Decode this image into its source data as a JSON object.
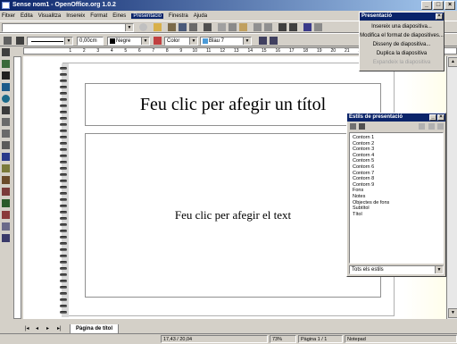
{
  "window": {
    "title": "Sense nom1 - OpenOffice.org 1.0.2"
  },
  "menubar": [
    "Fitxer",
    "Edita",
    "Visualitza",
    "Insereix",
    "Format",
    "Eines",
    "Presentació",
    "Finestra",
    "Ajuda"
  ],
  "toolbar": {
    "line_width": "0,00cm",
    "line_color": "Negre",
    "fill_type": "Color",
    "fill_color": "Blau 7"
  },
  "ruler": {
    "ticks": [
      "1",
      "2",
      "3",
      "4",
      "5",
      "6",
      "7",
      "8",
      "9",
      "10",
      "11",
      "12",
      "13",
      "14",
      "15",
      "16",
      "17",
      "18",
      "19",
      "20",
      "21",
      "22",
      "23",
      "24"
    ]
  },
  "slide": {
    "title_placeholder": "Feu clic per afegir un títol",
    "text_placeholder": "Feu clic per afegir el text"
  },
  "presentation_menu": {
    "title": "Presentació",
    "items": [
      {
        "label": "Insereix una diapositiva...",
        "enabled": true
      },
      {
        "label": "Modifica el format de diapositives...",
        "enabled": true
      },
      {
        "label": "Disseny de diapositiva...",
        "enabled": true
      },
      {
        "label": "Duplica la diapositiva",
        "enabled": true
      },
      {
        "label": "Expandeix la diapositiva",
        "enabled": false
      }
    ]
  },
  "styles_panel": {
    "title": "Estils de presentació",
    "styles": [
      "Contorn 1",
      "Contorn 2",
      "Contorn 3",
      "Contorn 4",
      "Contorn 5",
      "Contorn 6",
      "Contorn 7",
      "Contorn 8",
      "Contorn 9",
      "Fons",
      "Notes",
      "Objectes de fons",
      "Subtítol",
      "Títol"
    ],
    "filter": "Tots els estils"
  },
  "tabs": {
    "active": "Pàgina de títol"
  },
  "statusbar": {
    "position": "17,43 / 20,04",
    "zoom": "73%",
    "page": "Pàgina 1 / 1",
    "layout": "Notepad"
  }
}
